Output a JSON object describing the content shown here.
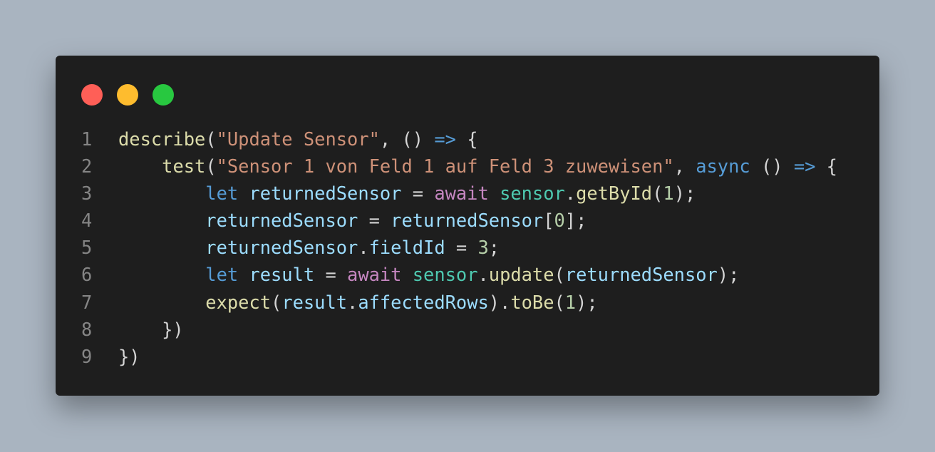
{
  "colors": {
    "page_background": "#a9b4c0",
    "editor_background": "#1e1e1e",
    "close_dot": "#ff5f57",
    "minimize_dot": "#febc2e",
    "maximize_dot": "#28c840",
    "line_number": "#858585",
    "function": "#dcdcaa",
    "string": "#ce9178",
    "keyword": "#569cd6",
    "control_keyword": "#c586c0",
    "variable": "#9cdcfe",
    "object": "#4ec9b0",
    "number": "#b5cea8",
    "punctuation": "#d4d4d4"
  },
  "window_controls": [
    {
      "name": "close",
      "icon": "close-dot-icon"
    },
    {
      "name": "minimize",
      "icon": "minimize-dot-icon"
    },
    {
      "name": "maximize",
      "icon": "maximize-dot-icon"
    }
  ],
  "code": {
    "language": "javascript",
    "lines": [
      {
        "number": "1",
        "tokens": [
          {
            "t": "describe",
            "k": "fn"
          },
          {
            "t": "(",
            "k": "pun"
          },
          {
            "t": "\"Update Sensor\"",
            "k": "str"
          },
          {
            "t": ", () ",
            "k": "pun"
          },
          {
            "t": "=>",
            "k": "kw"
          },
          {
            "t": " {",
            "k": "pun"
          }
        ]
      },
      {
        "number": "2",
        "tokens": [
          {
            "t": "    ",
            "k": "pun"
          },
          {
            "t": "test",
            "k": "fn"
          },
          {
            "t": "(",
            "k": "pun"
          },
          {
            "t": "\"Sensor 1 von Feld 1 auf Feld 3 zuwewisen\"",
            "k": "str"
          },
          {
            "t": ", ",
            "k": "pun"
          },
          {
            "t": "async",
            "k": "kw"
          },
          {
            "t": " () ",
            "k": "pun"
          },
          {
            "t": "=>",
            "k": "kw"
          },
          {
            "t": " {",
            "k": "pun"
          }
        ]
      },
      {
        "number": "3",
        "tokens": [
          {
            "t": "        ",
            "k": "pun"
          },
          {
            "t": "let",
            "k": "kw"
          },
          {
            "t": " ",
            "k": "pun"
          },
          {
            "t": "returnedSensor",
            "k": "var"
          },
          {
            "t": " = ",
            "k": "pun"
          },
          {
            "t": "await",
            "k": "ctl"
          },
          {
            "t": " ",
            "k": "pun"
          },
          {
            "t": "sensor",
            "k": "cls"
          },
          {
            "t": ".",
            "k": "pun"
          },
          {
            "t": "getById",
            "k": "fn"
          },
          {
            "t": "(",
            "k": "pun"
          },
          {
            "t": "1",
            "k": "num"
          },
          {
            "t": ");",
            "k": "pun"
          }
        ]
      },
      {
        "number": "4",
        "tokens": [
          {
            "t": "        ",
            "k": "pun"
          },
          {
            "t": "returnedSensor",
            "k": "var"
          },
          {
            "t": " = ",
            "k": "pun"
          },
          {
            "t": "returnedSensor",
            "k": "var"
          },
          {
            "t": "[",
            "k": "pun"
          },
          {
            "t": "0",
            "k": "num"
          },
          {
            "t": "];",
            "k": "pun"
          }
        ]
      },
      {
        "number": "5",
        "tokens": [
          {
            "t": "        ",
            "k": "pun"
          },
          {
            "t": "returnedSensor",
            "k": "var"
          },
          {
            "t": ".",
            "k": "pun"
          },
          {
            "t": "fieldId",
            "k": "var"
          },
          {
            "t": " = ",
            "k": "pun"
          },
          {
            "t": "3",
            "k": "num"
          },
          {
            "t": ";",
            "k": "pun"
          }
        ]
      },
      {
        "number": "6",
        "tokens": [
          {
            "t": "        ",
            "k": "pun"
          },
          {
            "t": "let",
            "k": "kw"
          },
          {
            "t": " ",
            "k": "pun"
          },
          {
            "t": "result",
            "k": "var"
          },
          {
            "t": " = ",
            "k": "pun"
          },
          {
            "t": "await",
            "k": "ctl"
          },
          {
            "t": " ",
            "k": "pun"
          },
          {
            "t": "sensor",
            "k": "cls"
          },
          {
            "t": ".",
            "k": "pun"
          },
          {
            "t": "update",
            "k": "fn"
          },
          {
            "t": "(",
            "k": "pun"
          },
          {
            "t": "returnedSensor",
            "k": "var"
          },
          {
            "t": ");",
            "k": "pun"
          }
        ]
      },
      {
        "number": "7",
        "tokens": [
          {
            "t": "        ",
            "k": "pun"
          },
          {
            "t": "expect",
            "k": "fn"
          },
          {
            "t": "(",
            "k": "pun"
          },
          {
            "t": "result",
            "k": "var"
          },
          {
            "t": ".",
            "k": "pun"
          },
          {
            "t": "affectedRows",
            "k": "var"
          },
          {
            "t": ").",
            "k": "pun"
          },
          {
            "t": "toBe",
            "k": "fn"
          },
          {
            "t": "(",
            "k": "pun"
          },
          {
            "t": "1",
            "k": "num"
          },
          {
            "t": ");",
            "k": "pun"
          }
        ]
      },
      {
        "number": "8",
        "tokens": [
          {
            "t": "    })",
            "k": "pun"
          }
        ]
      },
      {
        "number": "9",
        "tokens": [
          {
            "t": "})",
            "k": "pun"
          }
        ]
      }
    ]
  }
}
